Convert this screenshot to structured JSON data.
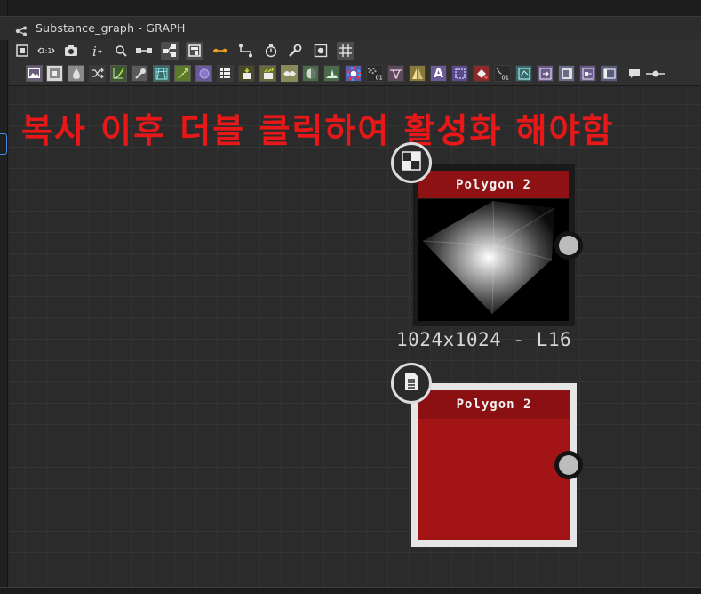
{
  "window": {
    "title": "Substance_graph - GRAPH"
  },
  "toolbar_main": {
    "buttons": [
      {
        "name": "frame-all-icon"
      },
      {
        "name": "zoom-1to1-icon",
        "label": "1:1"
      },
      {
        "name": "camera-icon"
      },
      {
        "name": "info-icon"
      },
      {
        "name": "search-icon"
      },
      {
        "name": "align-icon"
      },
      {
        "name": "node-view-icon"
      },
      {
        "name": "list-view-icon"
      },
      {
        "name": "link-style-icon"
      },
      {
        "name": "link-angle-icon"
      },
      {
        "name": "timer-icon"
      },
      {
        "name": "wrench-icon"
      },
      {
        "name": "preview-icon"
      },
      {
        "name": "grid-snap-icon"
      }
    ]
  },
  "toolbar_nodes": {
    "items": [
      {
        "name": "bitmap-node-icon",
        "bg": "#6a5d78"
      },
      {
        "name": "svg-node-icon",
        "bg": "#d8d8d8"
      },
      {
        "name": "levels-node-icon",
        "bg": "#8a8a8a"
      },
      {
        "name": "shuffle-node-icon",
        "bg": "#3a3a3a"
      },
      {
        "name": "curve-node-icon",
        "bg": "#3a5a2a"
      },
      {
        "name": "gradient-map-icon",
        "bg": "#5a5a5a"
      },
      {
        "name": "warp-node-icon",
        "bg": "#3a6a6a"
      },
      {
        "name": "pixel-processor-icon",
        "bg": "#5a7a2a"
      },
      {
        "name": "circle-node-icon",
        "bg": "#6a5a9a"
      },
      {
        "name": "tile-node-icon",
        "bg": "#3a3a3a"
      },
      {
        "name": "input-node-icon",
        "bg": "#4a4a2a"
      },
      {
        "name": "fx-map-icon",
        "bg": "#6a6a3a"
      },
      {
        "name": "blend-node-icon",
        "bg": "#8a8a5a"
      },
      {
        "name": "sharpen-node-icon",
        "bg": "#4a6a4a"
      },
      {
        "name": "histogram-node-icon",
        "bg": "#4a6a4a"
      },
      {
        "name": "hsl-node-icon",
        "bg": "#5a5ab0"
      },
      {
        "name": "noise-node-icon",
        "bg": "#2a2a2a",
        "label": "01"
      },
      {
        "name": "transform-node-icon",
        "bg": "#5a4a5a"
      },
      {
        "name": "mirror-node-icon",
        "bg": "#8a7a3a"
      },
      {
        "name": "text-node-icon",
        "bg": "#6a5a9a",
        "label": "A"
      },
      {
        "name": "selection-node-icon",
        "bg": "#5a4a8a"
      },
      {
        "name": "fill-node-icon",
        "bg": "#8a2a2a"
      },
      {
        "name": "value-node-icon",
        "bg": "#2a2a2a",
        "label": "01"
      },
      {
        "name": "distance-node-icon",
        "bg": "#3a6a6a"
      },
      {
        "name": "output-node-icon",
        "bg": "#6a5a8a"
      },
      {
        "name": "graph-instance-icon",
        "bg": "#6a6a8a"
      },
      {
        "name": "subgraph-node-icon",
        "bg": "#6a5a8a"
      },
      {
        "name": "frame-node-icon",
        "bg": "#5a5a7a"
      }
    ],
    "extra": [
      {
        "name": "comment-icon"
      },
      {
        "name": "pin-icon"
      }
    ]
  },
  "annotation": {
    "text": "복사 이후 더블 클릭하여 활성화 해야함",
    "color": "#e81818"
  },
  "nodes": [
    {
      "title": "Polygon 2",
      "resolution": "1024x1024 - L16",
      "badge_icon": "checker-icon",
      "header_color": "#8e1213"
    },
    {
      "title": "Polygon 2",
      "badge_icon": "document-icon",
      "header_color": "#8b1011",
      "body_color": "#a21416"
    }
  ]
}
